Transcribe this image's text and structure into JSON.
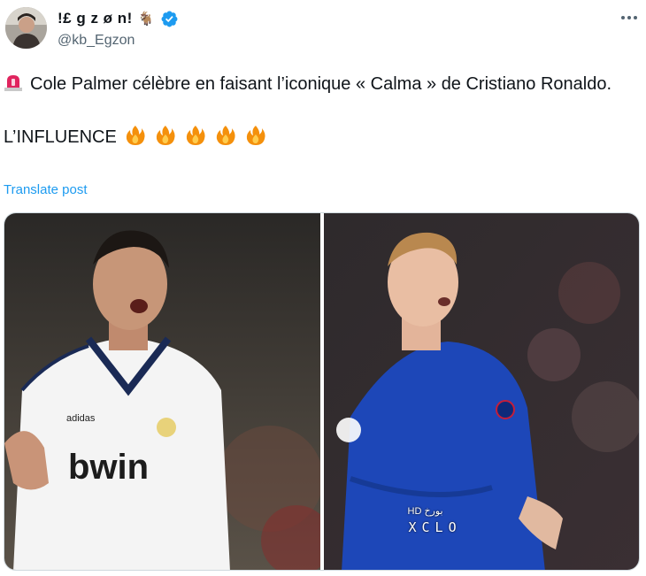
{
  "user": {
    "display_name": "!£ g z ø n!",
    "goat_emoji": "🐐",
    "handle": "@kb_Egzon"
  },
  "tweet": {
    "siren_icon": "rotating-light-icon",
    "line1": "Cole Palmer célèbre en faisant l’iconique « Calma » de Cristiano Ronaldo.",
    "line2": "L’INFLUENCE",
    "fire_icon": "fire-icon",
    "fire_count": 5,
    "translate_label": "Translate post"
  },
  "media": {
    "left": {
      "sponsor": "bwin",
      "kit_brand": "adidas"
    },
    "right": {
      "wm_small": "HD  بورخ",
      "wm_big": "XCLO"
    }
  },
  "colors": {
    "accent": "#1d9bf0",
    "verified": "#1d9bf0",
    "muted": "#536471"
  }
}
